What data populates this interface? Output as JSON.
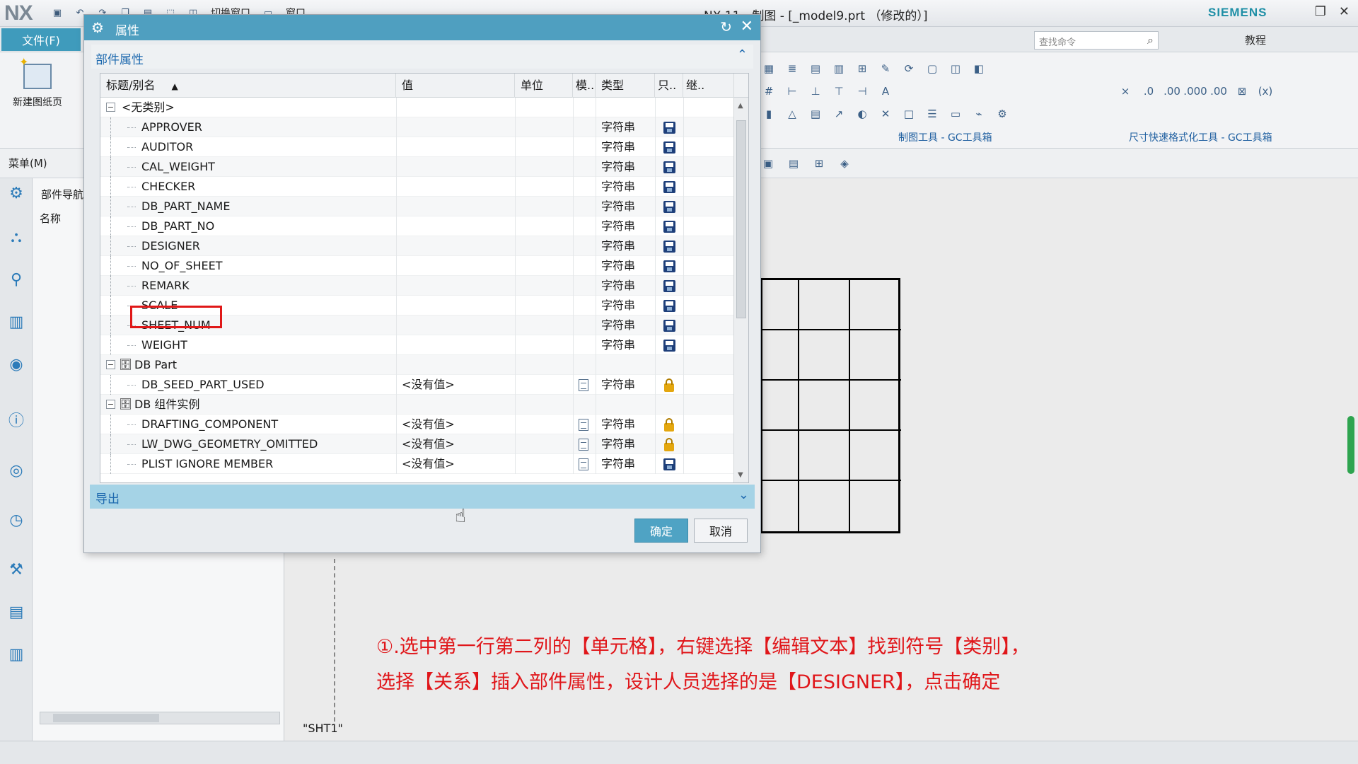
{
  "app": {
    "logo": "NX",
    "title": "NX 11 - 制图 - [_model9.prt （修改的）]",
    "brand": "SIEMENS",
    "qat_items": [
      "切换窗口",
      "窗口"
    ]
  },
  "ribbon": {
    "file_menu": "文件(F)",
    "search_placeholder": "查找命令",
    "help_label": "教程",
    "new_sheet_label": "新建图纸页",
    "group_labels": [
      "制图工具 - GC工具箱",
      "尺寸快速格式化工具 - GC工具箱"
    ],
    "menu_label": "菜单(M)"
  },
  "navigator": {
    "title": "部件导航",
    "column": "名称"
  },
  "canvas": {
    "sheet_label": "\"SHT1\"",
    "caption_line1": "①.选中第一行第二列的【单元格】，右键选择【编辑文本】找到符号【类别】，",
    "caption_line2": "选择【关系】插入部件属性，设计人员选择的是【DESIGNER】，点击确定"
  },
  "dialog": {
    "title": "属性",
    "section": "部件属性",
    "export_section": "导出",
    "ok": "确定",
    "cancel": "取消",
    "columns": {
      "title": "标题/别名",
      "value": "值",
      "unit": "单位",
      "mod": "模..",
      "type": "类型",
      "readonly": "只..",
      "inherit": "继.."
    },
    "groups": [
      {
        "name": "<无类别>",
        "rows": [
          {
            "title": "APPROVER",
            "value": "",
            "type": "字符串"
          },
          {
            "title": "AUDITOR",
            "value": "",
            "type": "字符串"
          },
          {
            "title": "CAL_WEIGHT",
            "value": "",
            "type": "字符串"
          },
          {
            "title": "CHECKER",
            "value": "",
            "type": "字符串"
          },
          {
            "title": "DB_PART_NAME",
            "value": "",
            "type": "字符串"
          },
          {
            "title": "DB_PART_NO",
            "value": "",
            "type": "字符串"
          },
          {
            "title": "DESIGNER",
            "value": "",
            "type": "字符串"
          },
          {
            "title": "NO_OF_SHEET",
            "value": "",
            "type": "字符串"
          },
          {
            "title": "REMARK",
            "value": "",
            "type": "字符串"
          },
          {
            "title": "SCALE",
            "value": "",
            "type": "字符串"
          },
          {
            "title": "SHEET_NUM",
            "value": "",
            "type": "字符串"
          },
          {
            "title": "WEIGHT",
            "value": "",
            "type": "字符串"
          }
        ]
      },
      {
        "name": "DB Part",
        "rows": [
          {
            "title": "DB_SEED_PART_USED",
            "value": "<没有值>",
            "type": "字符串"
          }
        ]
      },
      {
        "name": "DB 组件实例",
        "rows": [
          {
            "title": "DRAFTING_COMPONENT",
            "value": "<没有值>",
            "type": "字符串"
          },
          {
            "title": "LW_DWG_GEOMETRY_OMITTED",
            "value": "<没有值>",
            "type": "字符串"
          },
          {
            "title": "PLIST IGNORE MEMBER",
            "value": "<没有值>",
            "type": "字符串"
          }
        ]
      }
    ]
  }
}
